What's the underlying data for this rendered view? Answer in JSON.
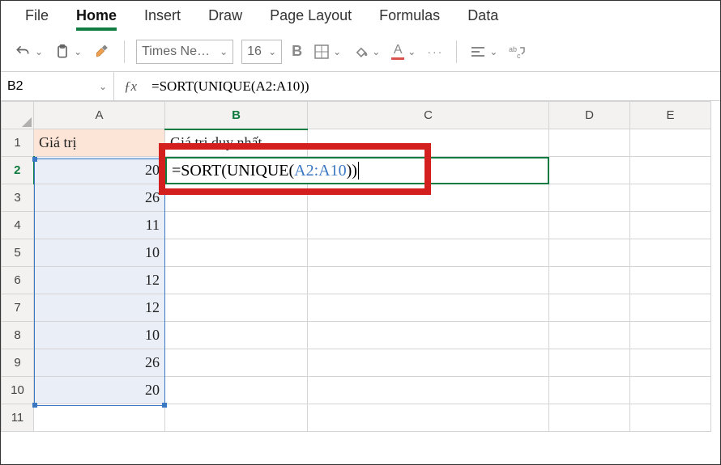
{
  "ribbon": {
    "tabs": [
      "File",
      "Home",
      "Insert",
      "Draw",
      "Page Layout",
      "Formulas",
      "Data"
    ],
    "active": "Home"
  },
  "toolbar": {
    "font_name": "Times Ne…",
    "font_size": "16"
  },
  "namebox": "B2",
  "formula_bar": "=SORT(UNIQUE(A2:A10))",
  "sheet": {
    "columns": [
      "A",
      "B",
      "C",
      "D",
      "E"
    ],
    "rows": [
      "1",
      "2",
      "3",
      "4",
      "5",
      "6",
      "7",
      "8",
      "9",
      "10",
      "11"
    ],
    "headers": {
      "A": "Giá trị",
      "B": "Giá trị duy nhất"
    },
    "colA": [
      "20",
      "26",
      "11",
      "10",
      "12",
      "12",
      "10",
      "26",
      "20"
    ],
    "editing_cell": "B2",
    "editing_text_prefix": "=SORT(UNIQUE(",
    "editing_text_ref": "A2:A10",
    "editing_text_suffix": "))"
  }
}
